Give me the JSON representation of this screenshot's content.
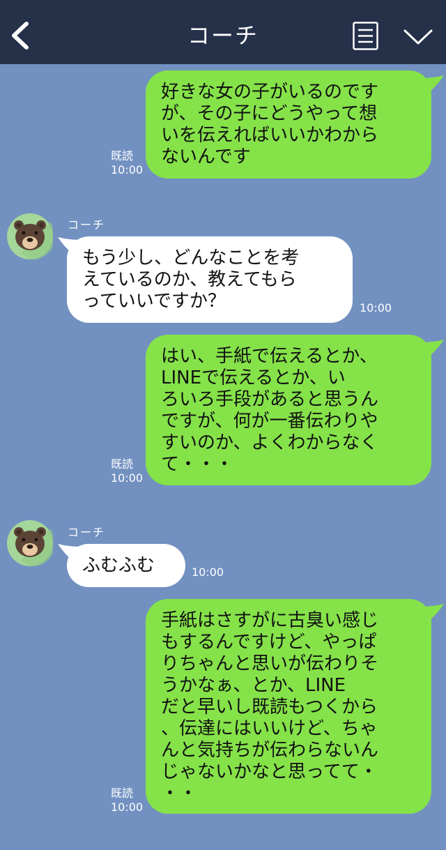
{
  "header": {
    "title": "コーチ"
  },
  "colors": {
    "header_bg": "#253049",
    "chat_bg": "#7291c1",
    "sent_bubble": "#85e249",
    "received_bubble": "#ffffff",
    "avatar_bg": "#a5d69a",
    "bear": "#5b4336"
  },
  "icons": {
    "back": "back-chevron-icon",
    "menu": "menu-list-icon",
    "collapse": "chevron-down-icon",
    "avatar": "bear-avatar-icon"
  },
  "messages": [
    {
      "direction": "sent",
      "text": "好きな女の子がいるのです\nが、その子にどうやって想\nいを伝えればいいかわから\nないんです",
      "read_label": "既読",
      "time": "10:00"
    },
    {
      "direction": "received",
      "sender": "コーチ",
      "text": "もう少し、どんなことを考\nえているのか、教えてもら\nっていいですか？",
      "time": "10:00"
    },
    {
      "direction": "sent",
      "text": "はい、手紙で伝えるとか、\nLINEで伝えるとか、い\nろいろ手段があると思うん\nですが、何が一番伝わりや\nすいのか、よくわからなく\nて・・・",
      "read_label": "既読",
      "time": "10:00"
    },
    {
      "direction": "received",
      "sender": "コーチ",
      "text": "ふむふむ",
      "time": "10:00"
    },
    {
      "direction": "sent",
      "text": "手紙はさすがに古臭い感じ\nもするんですけど、やっぱ\nりちゃんと思いが伝わりそ\nうかなぁ、とか、LINE\nだと早いし既読もつくから\n、伝達にはいいけど、ちゃ\nんと気持ちが伝わらないん\nじゃないかなと思ってて・\n・・",
      "read_label": "既読",
      "time": "10:00"
    }
  ]
}
